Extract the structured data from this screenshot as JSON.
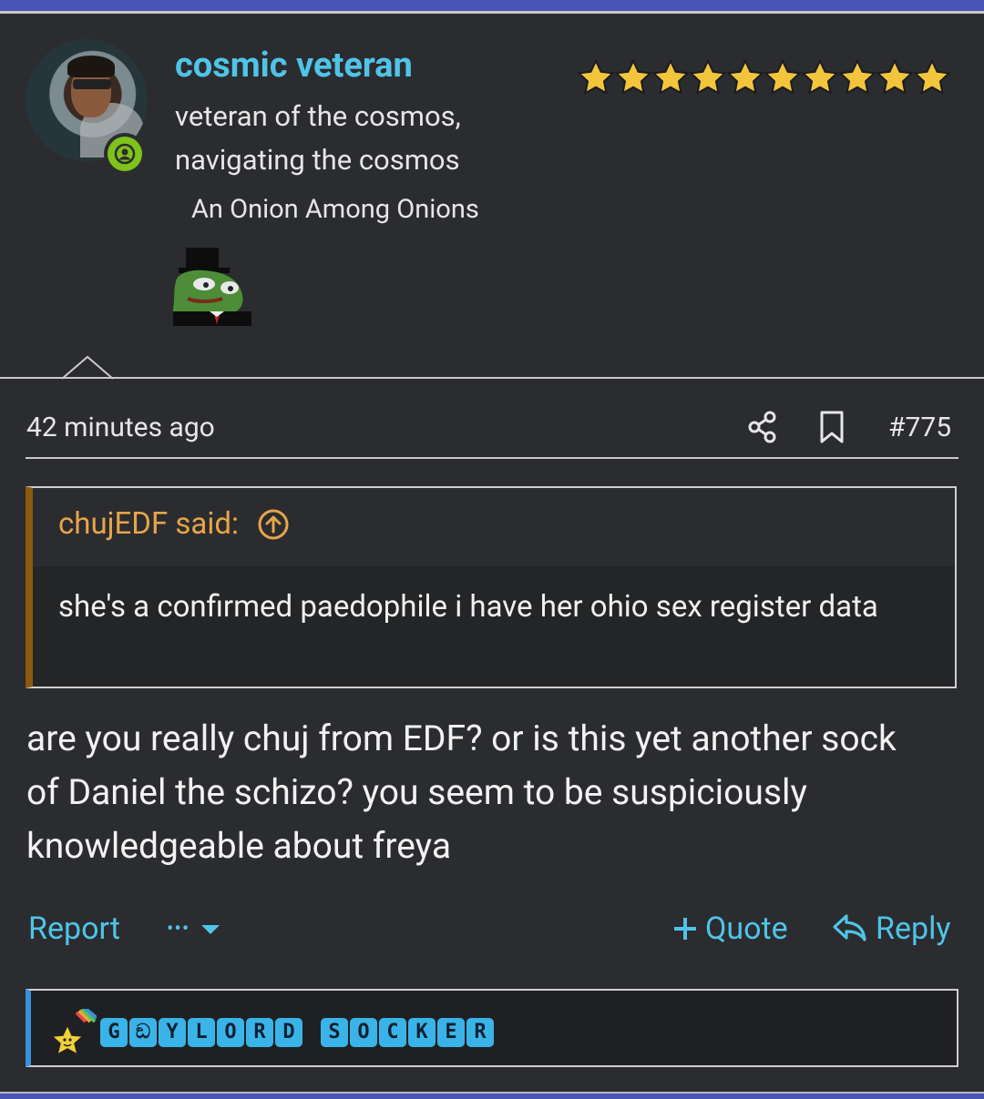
{
  "user": {
    "name": "cosmic veteran",
    "title": "veteran of the cosmos, navigating the cosmos",
    "rank": "An Onion Among Onions",
    "star_count": 10,
    "star_color": "#f2c53d"
  },
  "post": {
    "time": "42 minutes ago",
    "number": "#775",
    "quote": {
      "author": "chujEDF said:",
      "text": "she's a confirmed paedophile i have her ohio sex register data"
    },
    "body": "are you really chuj from EDF? or is this yet another sock of Daniel the schizo? you seem to be suspiciously knowledgeable about freya"
  },
  "actions": {
    "report": "Report",
    "more": "•••",
    "quote": "Quote",
    "reply": "Reply"
  },
  "signature": {
    "letters": [
      "G",
      "ඞ",
      "Y",
      "L",
      "O",
      "R",
      "D",
      " ",
      "S",
      "O",
      "C",
      "K",
      "E",
      "R"
    ]
  },
  "icons": [
    "share-icon",
    "bookmark-icon",
    "arrow-up-circle-icon",
    "chevron-down-icon",
    "plus-icon",
    "reply-icon",
    "person-icon",
    "star-icon"
  ],
  "colors": {
    "accent": "#4fc4e8",
    "quote_author": "#e7a54a",
    "online": "#7ec21a",
    "header_bar": "#4a55b8"
  }
}
